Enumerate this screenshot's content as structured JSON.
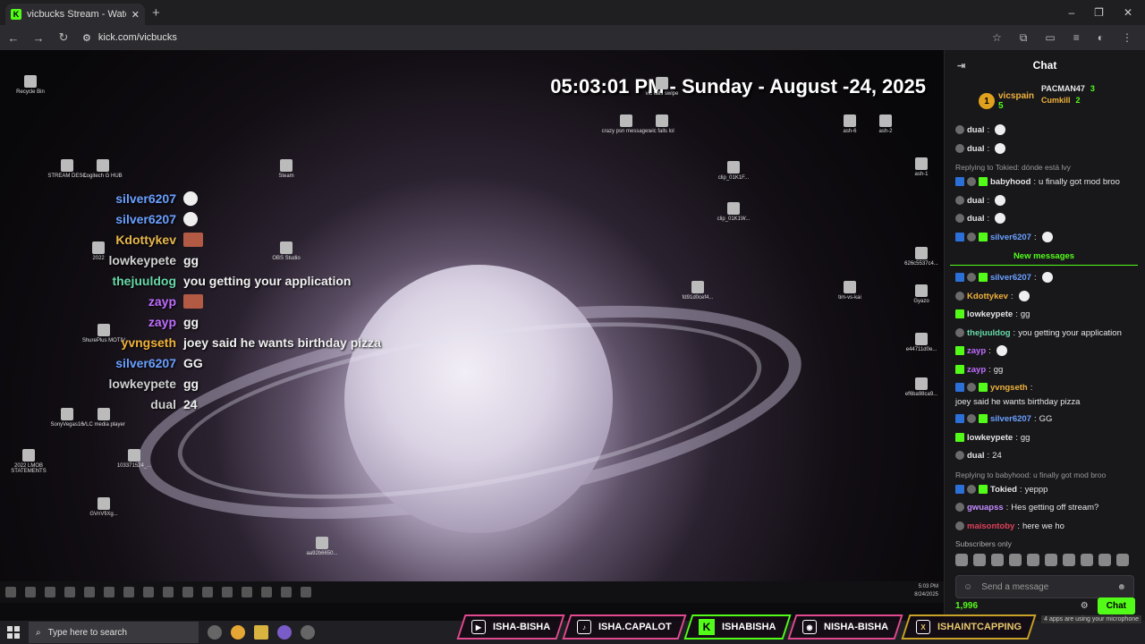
{
  "browser": {
    "tab_title": "vicbucks Stream - Watch Li",
    "new_tab": "+",
    "url": "kick.com/vicbucks",
    "window_controls": [
      "–",
      "❐",
      "✕"
    ]
  },
  "stream": {
    "clock_text": "05:03:01 PM - Sunday - August -24, 2025",
    "desktop_icons": [
      {
        "label": "Recycle Bin"
      },
      {
        "label": "STREAM DESC"
      },
      {
        "label": "Logitech G HUB"
      },
      {
        "label": "Steam"
      },
      {
        "label": "2022"
      },
      {
        "label": "OBS Studio"
      },
      {
        "label": "ShurePlus MOTIV"
      },
      {
        "label": "SonyVegas16"
      },
      {
        "label": "VLC media player"
      },
      {
        "label": "2022 LMOB STATEMENTS"
      },
      {
        "label": "103371524_..."
      },
      {
        "label": "GVnVfiXg..."
      },
      {
        "label": "aa92b6650..."
      },
      {
        "label": "crazy psn messages"
      },
      {
        "label": "vic falls lol"
      },
      {
        "label": "vic falls swipe"
      },
      {
        "label": "clip_01K1F..."
      },
      {
        "label": "clip_01K1W..."
      },
      {
        "label": "fd91d0cef4..."
      },
      {
        "label": "tim-vs-kai"
      },
      {
        "label": "Gyazo"
      },
      {
        "label": "ash-6"
      },
      {
        "label": "ash-2"
      },
      {
        "label": "ash-1"
      },
      {
        "label": "626c5537c4..."
      },
      {
        "label": "e44711d0e..."
      },
      {
        "label": "ef6ba98ca9..."
      }
    ],
    "overlay_chat": [
      {
        "user": "silver6207",
        "color": "#6aa0ff",
        "msg": "",
        "emote": "ghost"
      },
      {
        "user": "silver6207",
        "color": "#6aa0ff",
        "msg": "",
        "emote": "ghost"
      },
      {
        "user": "Kdottykev",
        "color": "#e8b74a",
        "msg": "",
        "emote": "pic"
      },
      {
        "user": "lowkeypete",
        "color": "#d0d0d0",
        "msg": "gg",
        "emote": ""
      },
      {
        "user": "thejuuldog",
        "color": "#67d9a8",
        "msg": "you getting your application",
        "emote": ""
      },
      {
        "user": "zayp",
        "color": "#c06dff",
        "msg": "",
        "emote": "pic"
      },
      {
        "user": "zayp",
        "color": "#c06dff",
        "msg": "gg",
        "emote": ""
      },
      {
        "user": "yvngseth",
        "color": "#f0b23a",
        "msg": "joey said he wants birthday pizza",
        "emote": ""
      },
      {
        "user": "silver6207",
        "color": "#6aa0ff",
        "msg": "GG",
        "emote": ""
      },
      {
        "user": "lowkeypete",
        "color": "#d0d0d0",
        "msg": "gg",
        "emote": ""
      },
      {
        "user": "dual",
        "color": "#d0d0d0",
        "msg": "24",
        "emote": ""
      }
    ],
    "inner_clock": {
      "time": "5:03 PM",
      "date": "8/24/2025"
    }
  },
  "chat": {
    "title": "Chat",
    "leaders": [
      {
        "rank": "1",
        "user": "vicspain",
        "count": "5",
        "color": "#f0b23a"
      },
      {
        "user": "PACMAN47",
        "count": "3",
        "color": "#e0e0e0"
      },
      {
        "user": "Cumkill",
        "count": "2",
        "color": "#f0b23a"
      }
    ],
    "messages_before": [
      {
        "user": "dual",
        "color": "#e6e6e6",
        "text": "",
        "badges": [
          "gray"
        ]
      },
      {
        "user": "dual",
        "color": "#e6e6e6",
        "text": "",
        "badges": [
          "gray"
        ]
      },
      {
        "reply": "Replying to Tokied: dónde está lvy"
      },
      {
        "user": "babyhood",
        "color": "#e6e6e6",
        "text": "u finally got mod broo",
        "badges": [
          "mod",
          "gray",
          "sub"
        ]
      },
      {
        "user": "dual",
        "color": "#e6e6e6",
        "text": "",
        "badges": [
          "gray"
        ]
      },
      {
        "user": "dual",
        "color": "#e6e6e6",
        "text": "",
        "badges": [
          "gray"
        ]
      },
      {
        "user": "silver6207",
        "color": "#6aa0ff",
        "text": "",
        "badges": [
          "mod",
          "gray",
          "sub"
        ]
      }
    ],
    "new_messages_label": "New messages",
    "messages_after": [
      {
        "user": "silver6207",
        "color": "#6aa0ff",
        "text": "",
        "badges": [
          "mod",
          "gray",
          "sub"
        ]
      },
      {
        "user": "Kdottykev",
        "color": "#f0b23a",
        "text": "",
        "badges": [
          "gray"
        ]
      },
      {
        "user": "lowkeypete",
        "color": "#e6e6e6",
        "text": "gg",
        "badges": [
          "sub"
        ]
      },
      {
        "user": "thejuuldog",
        "color": "#67d9a8",
        "text": "you getting your application",
        "badges": [
          "gray"
        ]
      },
      {
        "user": "zayp",
        "color": "#c06dff",
        "text": "",
        "badges": [
          "sub"
        ]
      },
      {
        "user": "zayp",
        "color": "#c06dff",
        "text": "gg",
        "badges": [
          "sub"
        ]
      },
      {
        "user": "yvngseth",
        "color": "#f0b23a",
        "text": "joey said he wants birthday pizza",
        "badges": [
          "mod",
          "gray",
          "sub"
        ]
      },
      {
        "user": "silver6207",
        "color": "#6aa0ff",
        "text": "GG",
        "badges": [
          "mod",
          "gray",
          "sub"
        ]
      },
      {
        "user": "lowkeypete",
        "color": "#e6e6e6",
        "text": "gg",
        "badges": [
          "sub"
        ]
      },
      {
        "user": "dual",
        "color": "#e6e6e6",
        "text": "24",
        "badges": [
          "gray"
        ]
      },
      {
        "reply": "Replying to babyhood: u finally got mod broo"
      },
      {
        "user": "Tokied",
        "color": "#e6e6e6",
        "text": "yeppp",
        "badges": [
          "mod",
          "gray",
          "sub"
        ]
      },
      {
        "user": "gwuapss",
        "color": "#c58bff",
        "text": "Hes getting off stream?",
        "badges": [
          "gray"
        ]
      },
      {
        "user": "maisontoby",
        "color": "#e0405a",
        "text": "here we ho",
        "badges": [
          "gray"
        ]
      }
    ],
    "subscribers_only": "Subscribers only",
    "input_placeholder": "Send a message",
    "points": "1,996",
    "chat_button": "Chat"
  },
  "taskbar": {
    "search_placeholder": "Type here to search"
  },
  "socials": [
    {
      "icon": "▶",
      "label": "ISHA-BISHA",
      "kind": "youtube"
    },
    {
      "icon": "♪",
      "label": "ISHA.CAPALOT",
      "kind": "tiktok"
    },
    {
      "icon": "K",
      "label": "ISHABISHA",
      "kind": "kick"
    },
    {
      "icon": "◉",
      "label": "NISHA-BISHA",
      "kind": "discord"
    },
    {
      "icon": "X",
      "label": "ISHAINTCAPPING",
      "kind": "x"
    }
  ],
  "tray_note": "4 apps are using your microphone"
}
